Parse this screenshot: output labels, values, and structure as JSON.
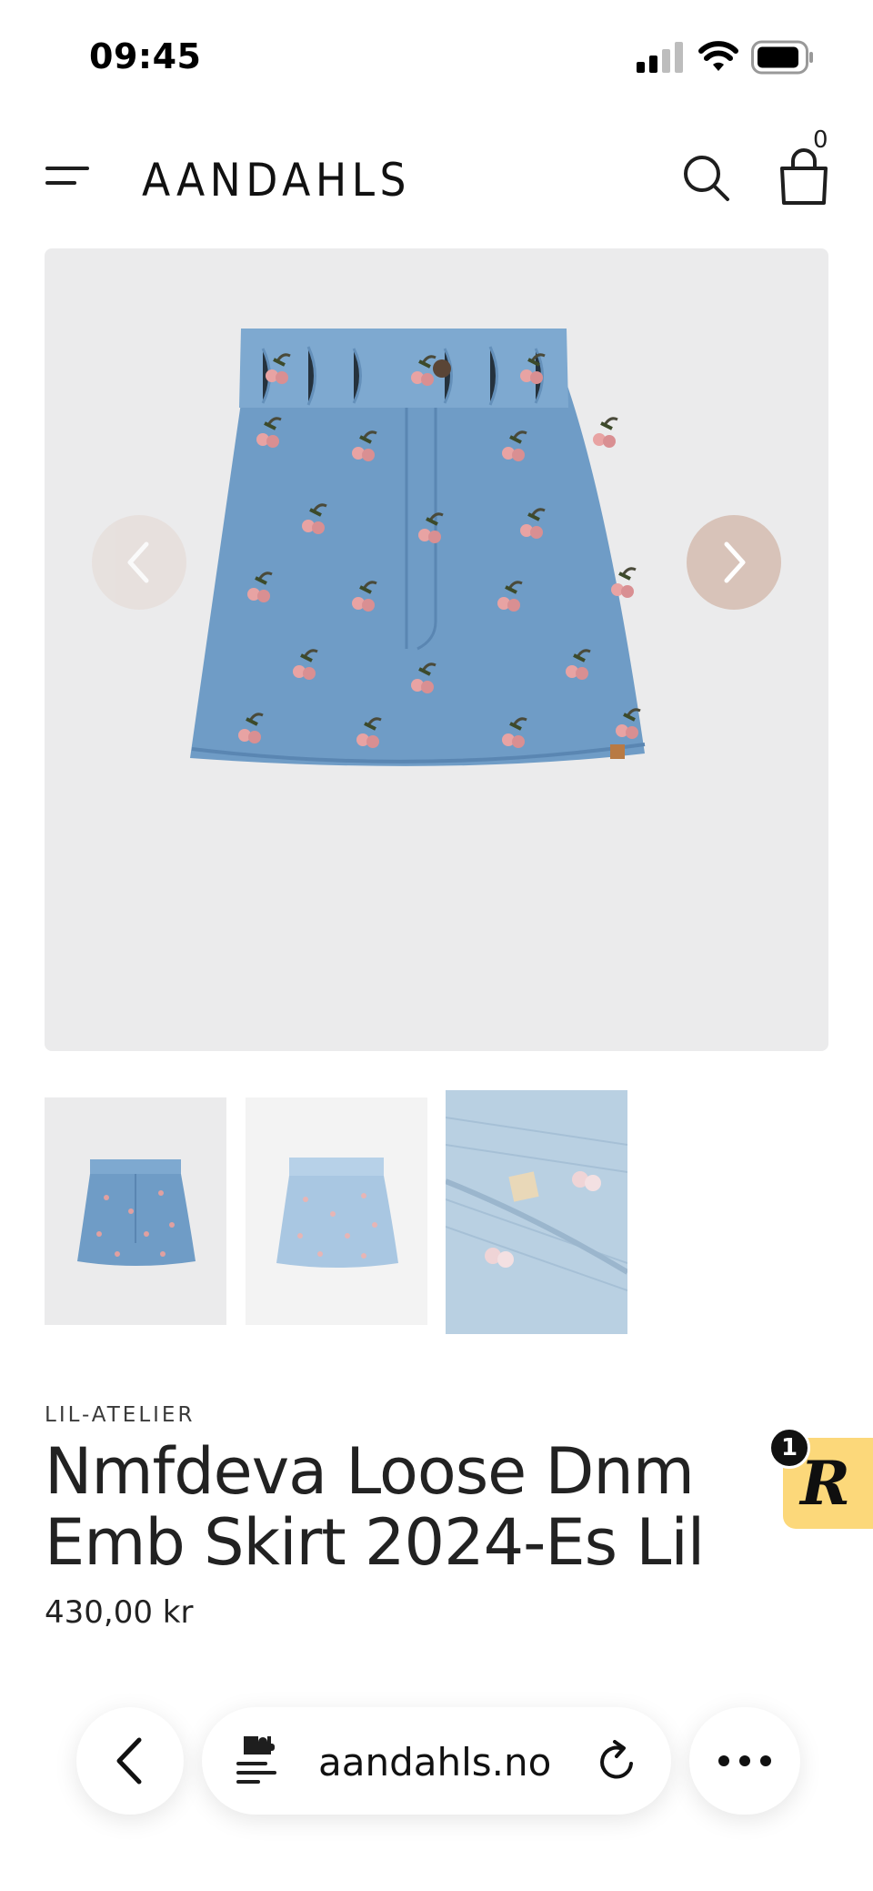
{
  "status_bar": {
    "time": "09:45",
    "icons": [
      "signal-icon",
      "wifi-icon",
      "battery-icon"
    ]
  },
  "header": {
    "logo_text": "AANDAHLS",
    "cart_count": "0",
    "icons": [
      "menu-icon",
      "search-icon",
      "cart-icon"
    ]
  },
  "gallery": {
    "main_image": "denim skirt with embroidered cherries",
    "thumbnails": [
      {
        "name": "thumbnail-1",
        "selected": true
      },
      {
        "name": "thumbnail-2",
        "selected": false
      },
      {
        "name": "thumbnail-3",
        "selected": false
      }
    ],
    "icons": [
      "chevron-left-icon",
      "chevron-right-icon"
    ]
  },
  "product": {
    "brand": "LIL-ATELIER",
    "title": "Nmfdeva Loose Dnm Emb Skirt 2024-Es Lil",
    "price": "430,00 kr"
  },
  "review_widget": {
    "badge_count": "1",
    "logo_letter": "R",
    "color": "#fcd87a"
  },
  "browser": {
    "url": "aandahls.no",
    "icons": [
      "back-icon",
      "site-settings-icon",
      "reload-icon",
      "more-icon"
    ]
  },
  "colors": {
    "image_background": "#ebebec",
    "next_button": "#d8c3b9",
    "prev_button": "#e6ddd9",
    "text": "#222222"
  }
}
